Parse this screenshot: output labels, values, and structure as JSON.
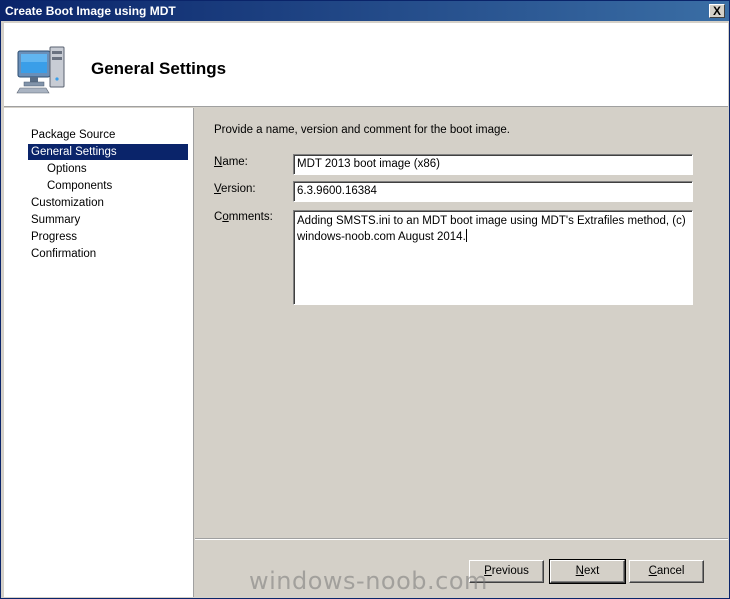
{
  "window": {
    "title": "Create Boot Image using MDT",
    "close_glyph": "X"
  },
  "header": {
    "title": "General Settings",
    "icon": "computer-icon"
  },
  "sidebar": {
    "items": [
      {
        "label": "Package Source",
        "selected": false,
        "sub": false
      },
      {
        "label": "General Settings",
        "selected": true,
        "sub": false
      },
      {
        "label": "Options",
        "selected": false,
        "sub": true
      },
      {
        "label": "Components",
        "selected": false,
        "sub": true
      },
      {
        "label": "Customization",
        "selected": false,
        "sub": false
      },
      {
        "label": "Summary",
        "selected": false,
        "sub": false
      },
      {
        "label": "Progress",
        "selected": false,
        "sub": false
      },
      {
        "label": "Confirmation",
        "selected": false,
        "sub": false
      }
    ]
  },
  "form": {
    "instruction": "Provide a name, version and comment for the boot image.",
    "name": {
      "label_hotkey": "N",
      "label_rest": "ame:",
      "value": "MDT 2013 boot image (x86)"
    },
    "version": {
      "label_hotkey": "V",
      "label_rest": "ersion:",
      "value": "6.3.9600.16384"
    },
    "comments": {
      "label_pre": "C",
      "label_hotkey": "o",
      "label_rest": "mments:",
      "value": "Adding SMSTS.ini to an MDT boot image using MDT's Extrafiles method, (c) windows-noob.com August 2014."
    }
  },
  "buttons": {
    "previous": {
      "hotkey": "P",
      "rest": "revious"
    },
    "next": {
      "hotkey": "N",
      "rest": "ext"
    },
    "cancel": {
      "hotkey": "C",
      "rest": "ancel"
    }
  },
  "watermark": "windows-noob.com",
  "colors": {
    "selection": "#0a246a",
    "titlebar": "#0a246a",
    "dialog_bg": "#d4d0c8"
  }
}
